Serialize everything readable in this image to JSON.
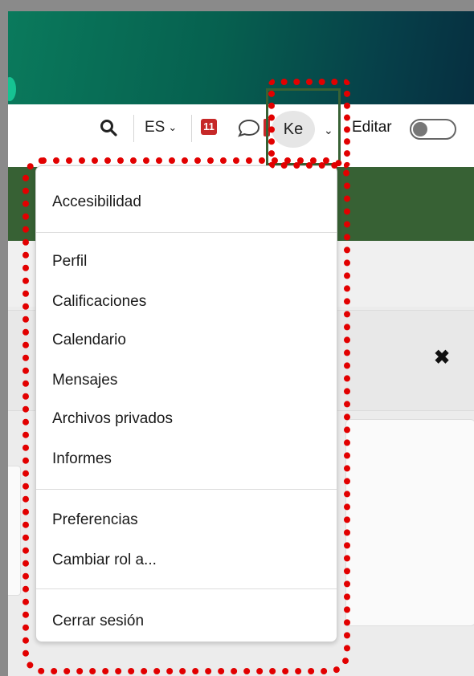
{
  "navbar": {
    "search_icon": "search-icon",
    "language": "ES",
    "notification_count": "11",
    "user_initials": "Ke",
    "edit_label": "Editar"
  },
  "user_menu": {
    "items_group1": [
      "Accesibilidad"
    ],
    "items_group2": [
      "Perfil",
      "Calificaciones",
      "Calendario",
      "Mensajes",
      "Archivos privados",
      "Informes"
    ],
    "items_group3": [
      "Preferencias",
      "Cambiar rol a..."
    ],
    "items_group4": [
      "Cerrar sesión"
    ]
  },
  "colors": {
    "accent_green": "#376134",
    "highlight": "#e20000",
    "badge_red": "#c62828"
  }
}
